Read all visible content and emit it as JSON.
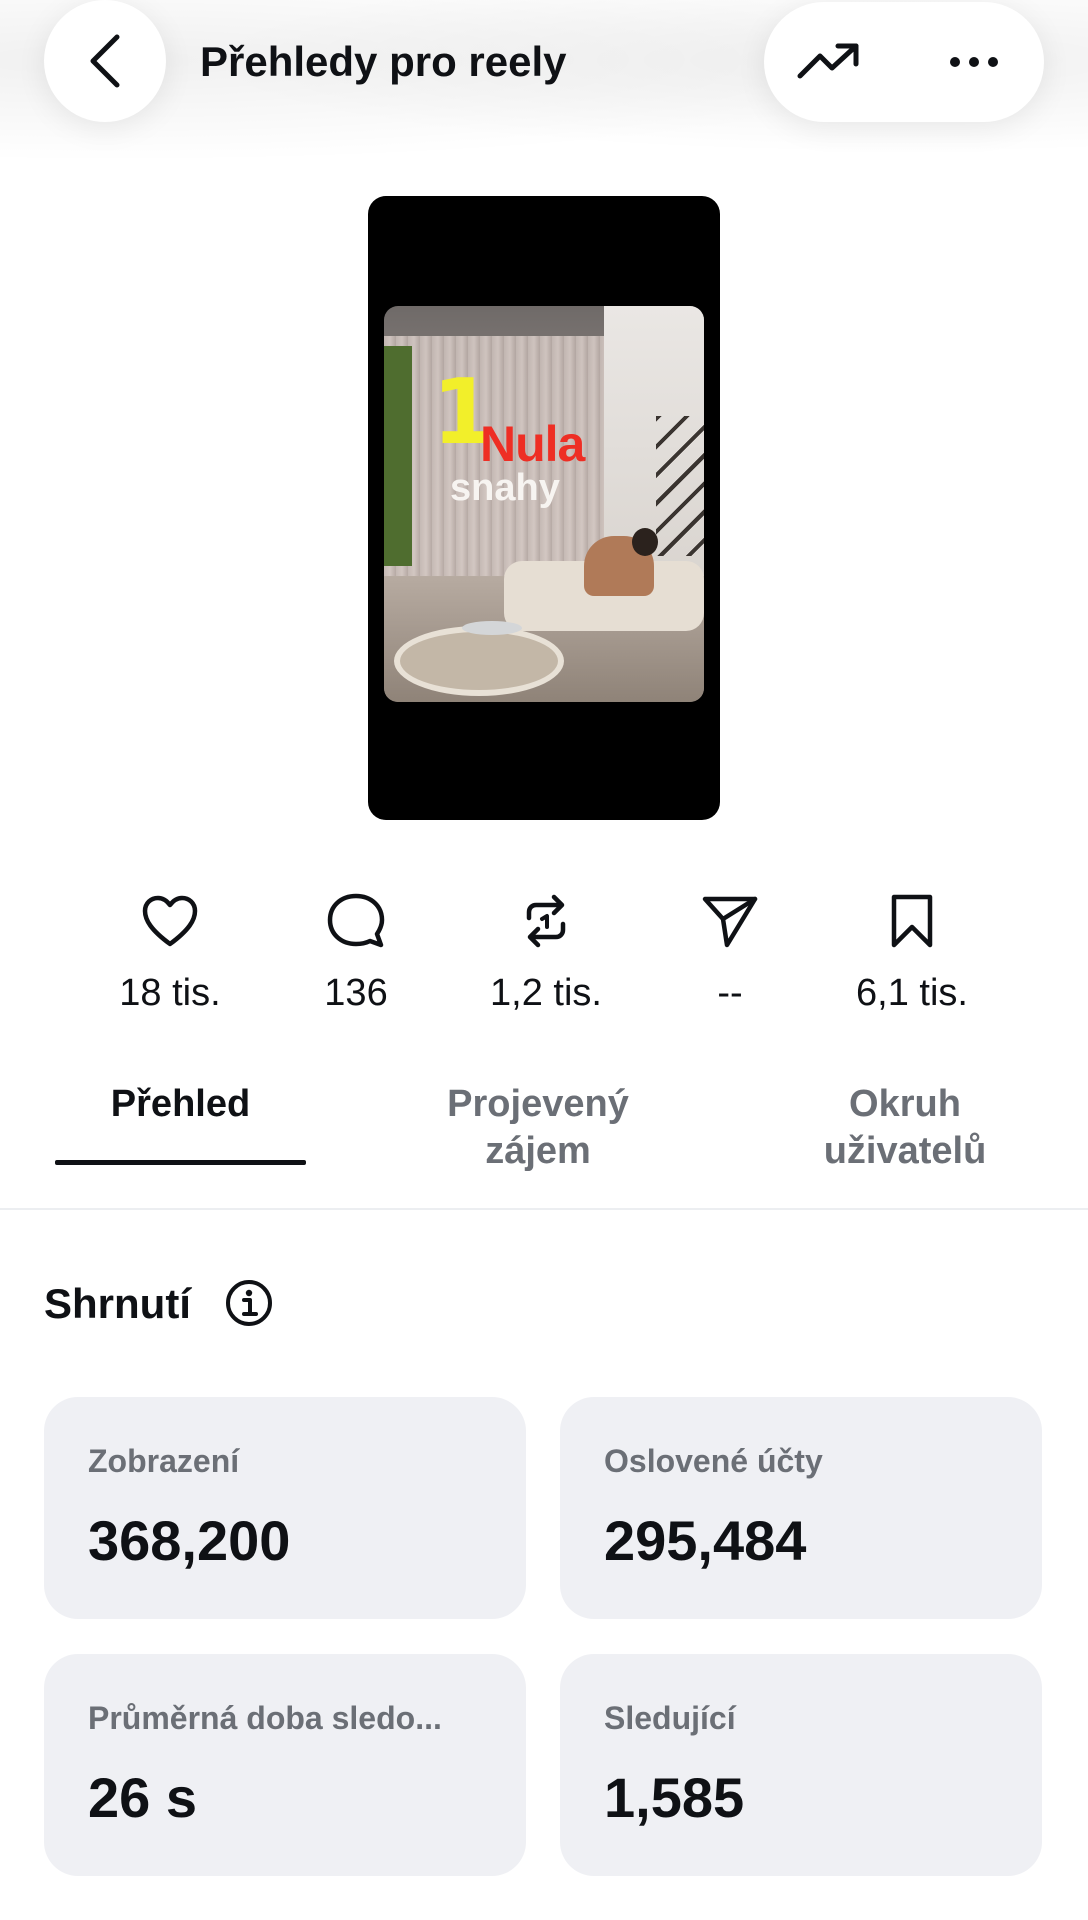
{
  "header": {
    "title": "Přehledy pro reely",
    "back_icon": "chevron-left-icon",
    "trend_icon": "trending-up-icon",
    "more_icon": "more-horizontal-icon"
  },
  "reel": {
    "overlay_number": "1",
    "overlay_word": "Nula",
    "overlay_sub": "snahy"
  },
  "stats": [
    {
      "icon": "heart-icon",
      "value": "18 tis."
    },
    {
      "icon": "comment-icon",
      "value": "136"
    },
    {
      "icon": "repost-icon",
      "value": "1,2 tis."
    },
    {
      "icon": "send-icon",
      "value": "--"
    },
    {
      "icon": "bookmark-icon",
      "value": "6,1 tis."
    }
  ],
  "tabs": [
    {
      "line1": "Přehled",
      "line2": ""
    },
    {
      "line1": "Projevený",
      "line2": "zájem"
    },
    {
      "line1": "Okruh",
      "line2": "uživatelů"
    }
  ],
  "summary": {
    "title": "Shrnutí",
    "cards": [
      {
        "label": "Zobrazení",
        "value": "368,200"
      },
      {
        "label": "Oslovené účty",
        "value": "295,484"
      },
      {
        "label": "Průměrná doba sledo...",
        "value": "26 s"
      },
      {
        "label": "Sledující",
        "value": "1,585"
      }
    ]
  }
}
